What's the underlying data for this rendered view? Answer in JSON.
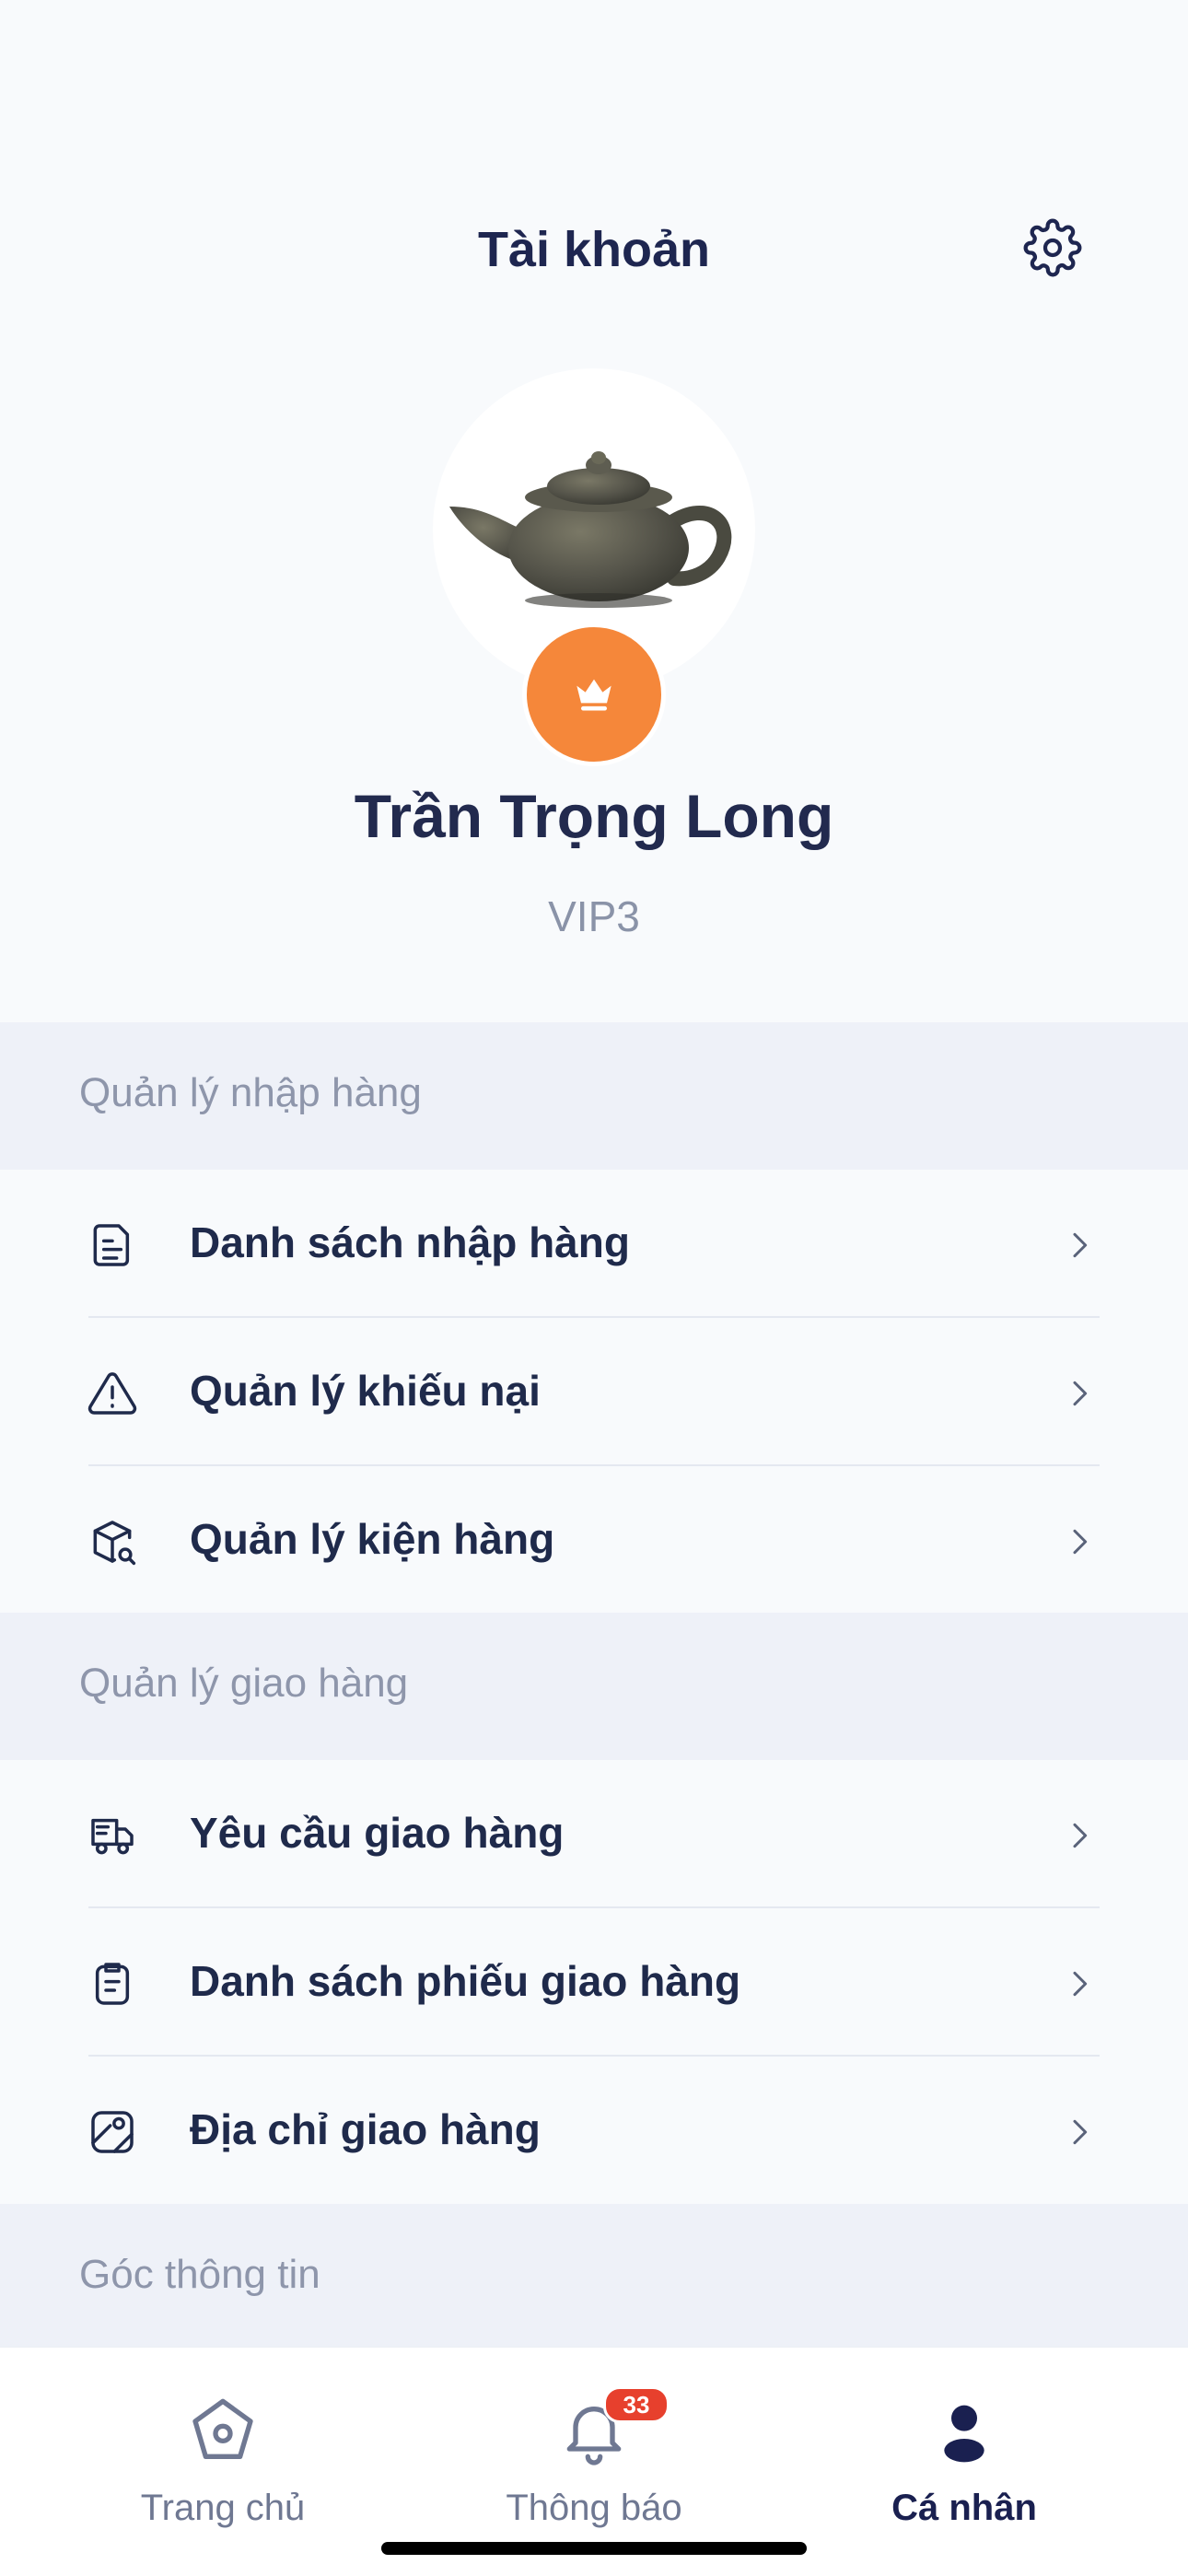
{
  "header": {
    "title": "Tài khoản",
    "settings_icon": "gear-icon"
  },
  "profile": {
    "name": "Trần Trọng Long",
    "level": "VIP3",
    "badge_icon": "crown-icon",
    "badge_color": "#F5873A"
  },
  "sections": [
    {
      "title": "Quản lý nhập hàng",
      "items": [
        {
          "label": "Danh sách nhập hàng",
          "icon": "clipboard-list-icon"
        },
        {
          "label": "Quản lý khiếu nại",
          "icon": "warning-triangle-icon"
        },
        {
          "label": "Quản lý kiện hàng",
          "icon": "package-search-icon"
        }
      ]
    },
    {
      "title": "Quản lý giao hàng",
      "items": [
        {
          "label": "Yêu cầu giao hàng",
          "icon": "delivery-truck-icon"
        },
        {
          "label": "Danh sách phiếu giao hàng",
          "icon": "clipboard-receipt-icon"
        },
        {
          "label": "Địa chỉ giao hàng",
          "icon": "map-location-icon"
        }
      ]
    },
    {
      "title": "Góc thông tin",
      "items": []
    }
  ],
  "tabbar": {
    "tabs": [
      {
        "label": "Trang chủ",
        "icon": "home-icon",
        "active": false
      },
      {
        "label": "Thông báo",
        "icon": "bell-icon",
        "active": false,
        "badge": "33"
      },
      {
        "label": "Cá nhân",
        "icon": "user-icon",
        "active": true
      }
    ]
  },
  "colors": {
    "accent": "#F5873A",
    "text_primary": "#1F2A4B",
    "section_bg": "#EEF1F8",
    "badge_red": "#E7402D"
  }
}
